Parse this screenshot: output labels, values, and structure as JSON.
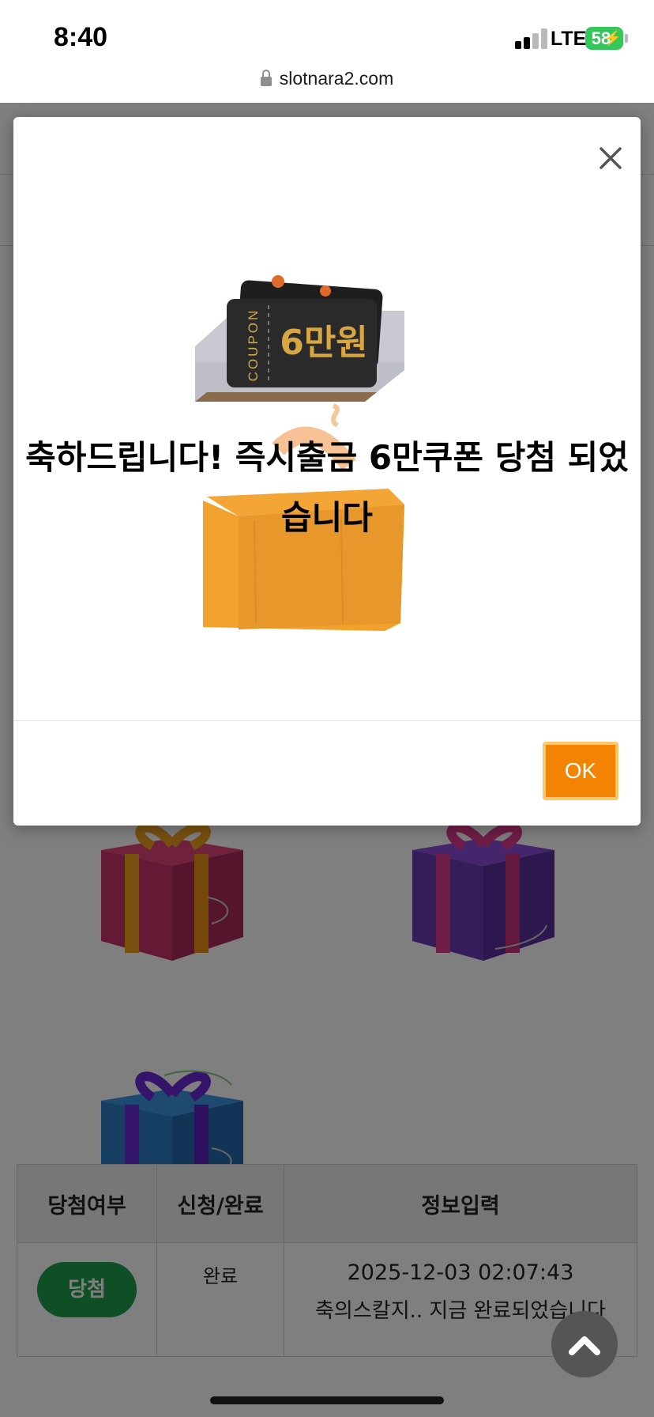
{
  "status_bar": {
    "time": "8:40",
    "network": "LTE",
    "battery": "58"
  },
  "browser": {
    "url": "slotnara2.com"
  },
  "modal": {
    "title": "축하드립니다! 즉시출금 6만쿠폰 당첨 되었습니다",
    "coupon_label": "COUPON",
    "coupon_amount": "6만원",
    "ok_label": "OK"
  },
  "table": {
    "headers": [
      "당첨여부",
      "신청/완료",
      "정보입력"
    ],
    "rows": [
      {
        "status_badge": "당첨",
        "state": "완료",
        "datetime": "2025-12-03 02:07:43",
        "message": "축의스칼지.. 지금 완료되었습니다"
      }
    ]
  },
  "colors": {
    "accent_ok": "#f28303",
    "badge_green": "#1e9e4a",
    "overlay": "rgba(0,0,0,0.5)"
  }
}
